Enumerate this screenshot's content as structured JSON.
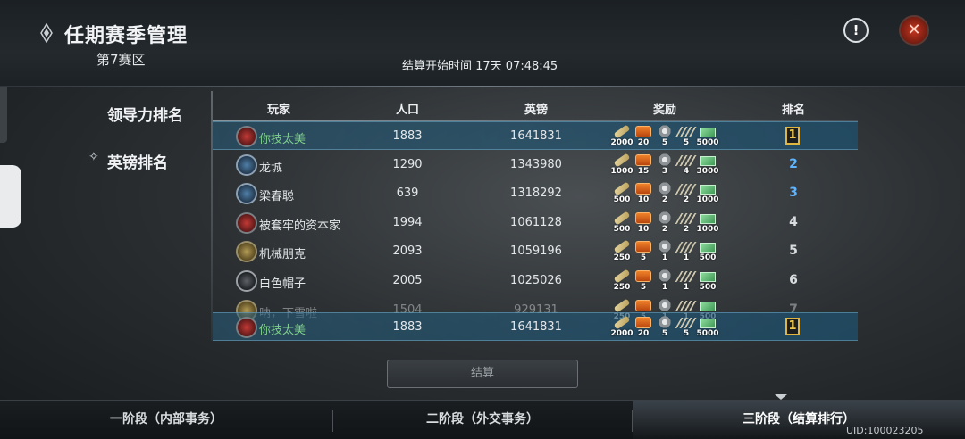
{
  "header": {
    "title": "任期赛季管理",
    "subtitle": "第7赛区",
    "settle_time": "结算开始时间 17天 07:48:45"
  },
  "sidebar": {
    "items": [
      {
        "label": "领导力排名",
        "active": false
      },
      {
        "label": "英镑排名",
        "active": true
      }
    ]
  },
  "table": {
    "headers": {
      "player": "玩家",
      "population": "人口",
      "pounds": "英镑",
      "reward": "奖励",
      "rank": "排名"
    },
    "reward_icons": [
      "scroll-icon",
      "chest-icon",
      "gear-icon",
      "ladder-icon",
      "cash-icon"
    ],
    "rows": [
      {
        "name": "你技太美",
        "avatar": "red",
        "population": "1883",
        "pounds": "1641831",
        "rewards": [
          "2000",
          "20",
          "5",
          "5",
          "5000"
        ],
        "rank": "1",
        "me": true
      },
      {
        "name": "龙城",
        "avatar": "blue",
        "population": "1290",
        "pounds": "1343980",
        "rewards": [
          "1000",
          "15",
          "3",
          "4",
          "3000"
        ],
        "rank": "2",
        "me": false
      },
      {
        "name": "梁春聪",
        "avatar": "blue",
        "population": "639",
        "pounds": "1318292",
        "rewards": [
          "500",
          "10",
          "2",
          "2",
          "1000"
        ],
        "rank": "3",
        "me": false
      },
      {
        "name": "被套牢的资本家",
        "avatar": "red",
        "population": "1994",
        "pounds": "1061128",
        "rewards": [
          "500",
          "10",
          "2",
          "2",
          "1000"
        ],
        "rank": "4",
        "me": false
      },
      {
        "name": "机械朋克",
        "avatar": "gold",
        "population": "2093",
        "pounds": "1059196",
        "rewards": [
          "250",
          "5",
          "1",
          "1",
          "500"
        ],
        "rank": "5",
        "me": false
      },
      {
        "name": "白色帽子",
        "avatar": "dark",
        "population": "2005",
        "pounds": "1025026",
        "rewards": [
          "250",
          "5",
          "1",
          "1",
          "500"
        ],
        "rank": "6",
        "me": false
      },
      {
        "name": "呐，下雪啦",
        "avatar": "gold",
        "population": "1504",
        "pounds": "929131",
        "rewards": [
          "250",
          "5",
          "1",
          "1",
          "500"
        ],
        "rank": "7",
        "me": false
      }
    ],
    "pinned_self": {
      "name": "你技太美",
      "avatar": "red",
      "population": "1883",
      "pounds": "1641831",
      "rewards": [
        "2000",
        "20",
        "5",
        "5",
        "5000"
      ],
      "rank": "1"
    }
  },
  "settle_button": "结算",
  "bottom_tabs": [
    {
      "label": "一阶段（内部事务）",
      "active": false
    },
    {
      "label": "二阶段（外交事务）",
      "active": false
    },
    {
      "label": "三阶段（结算排行）",
      "active": true
    }
  ],
  "uid": "UID:100023205"
}
